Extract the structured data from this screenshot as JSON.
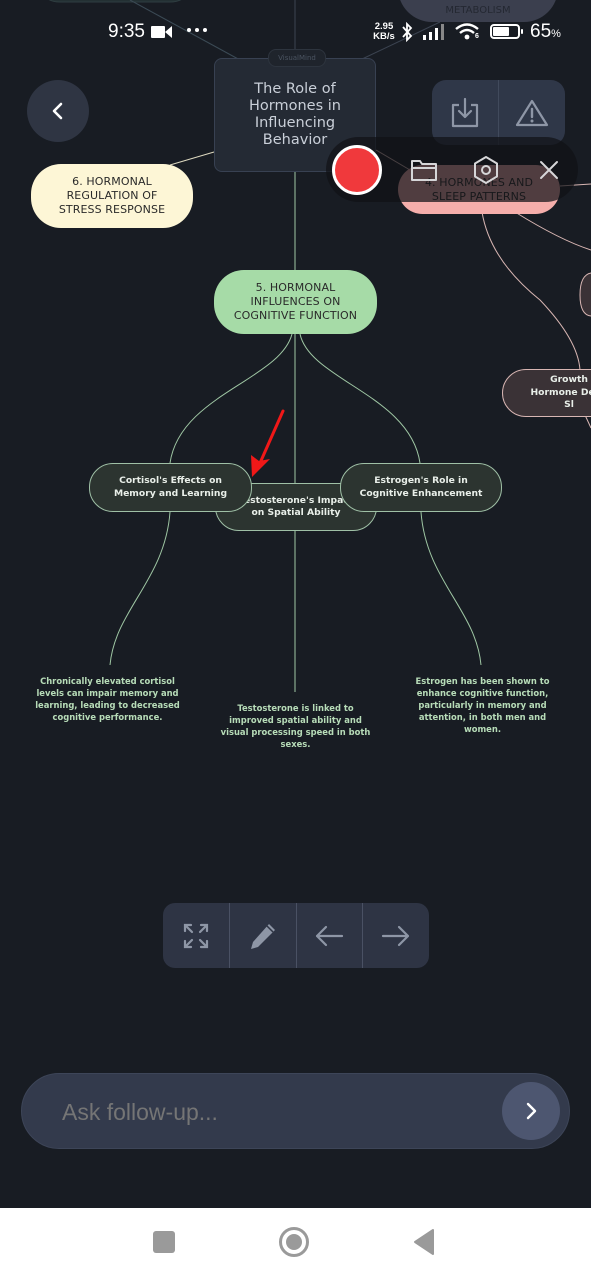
{
  "status_bar": {
    "time": "9:35",
    "net_speed_value": "2.95",
    "net_speed_unit": "KB/s",
    "wifi_label": "6",
    "battery": "65",
    "battery_unit": "%",
    "battery_level": 0.65
  },
  "mindmap": {
    "brand": "VisualMind",
    "root": "The Role of Hormones in Influencing Behavior",
    "partial_top_right": "METABOLISM",
    "topics": {
      "stress": "6. HORMONAL REGULATION OF STRESS RESPONSE",
      "cognitive": "5. HORMONAL INFLUENCES ON COGNITIVE FUNCTION",
      "sleep": "4. HORMONES AND SLEEP PATTERNS"
    },
    "subtopics": {
      "cortisol": "Cortisol's Effects on Memory and Learning",
      "testosterone": "Testosterone's Impact on Spatial Ability",
      "estrogen": "Estrogen's Role in Cognitive Enhancement",
      "growth_hormone": "Growth Hormone Deep Sl"
    },
    "details": {
      "cortisol": "Chronically elevated cortisol levels can impair memory and learning, leading to decreased cognitive performance.",
      "testosterone": "Testosterone is linked to improved spatial ability and visual processing speed in both sexes.",
      "estrogen": "Estrogen has been shown to enhance cognitive function, particularly in memory and attention, in both men and women."
    }
  },
  "colors": {
    "background": "#181c23",
    "topic_stress": "#fdf6d6",
    "topic_cognitive": "#a6dba7",
    "topic_sleep": "#f5aeab",
    "record": "#f0393c",
    "annotation_arrow": "#f01818"
  },
  "header_buttons": {
    "back": "back",
    "download": "download",
    "report": "report"
  },
  "recorder_overlay": {
    "record": "record",
    "folder": "folder",
    "settings": "settings",
    "close": "close"
  },
  "toolbar": {
    "fit": "fit-screen",
    "edit": "edit",
    "prev": "previous",
    "next": "next"
  },
  "followup": {
    "placeholder": "Ask follow-up...",
    "value": ""
  },
  "nav": {
    "recents": "recents",
    "home": "home",
    "back": "back"
  }
}
